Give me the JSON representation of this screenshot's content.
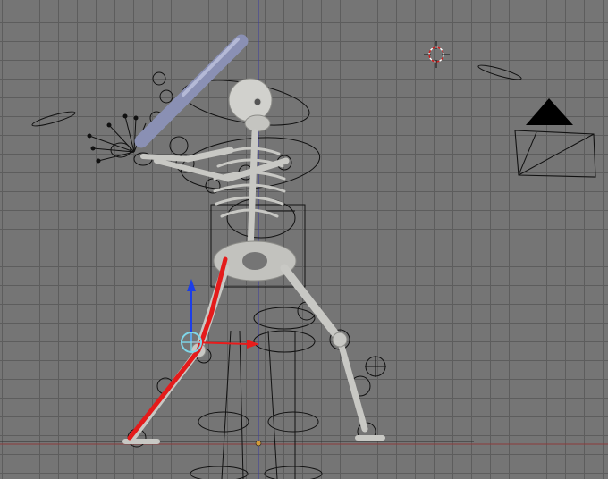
{
  "viewport": {
    "view_type": "3D viewport",
    "background_color": "#757575",
    "grid_color": "#5d5d5d",
    "x_axis_color": "#8e3a3a",
    "z_axis_color": "#3a3aa0"
  },
  "scene": {
    "subject": "skeleton-batter",
    "bat_color": "#8a90b4",
    "bone_color": "#c8c8c4",
    "selected_bone_color": "#e41b1b",
    "manipulator_colors": {
      "x": "#e81c1c",
      "z": "#1c3ee8",
      "center": "#7fd6e8"
    }
  },
  "icons": [
    "3d-cursor-icon",
    "lamp-icon",
    "camera-icon",
    "origin-dot-icon"
  ]
}
